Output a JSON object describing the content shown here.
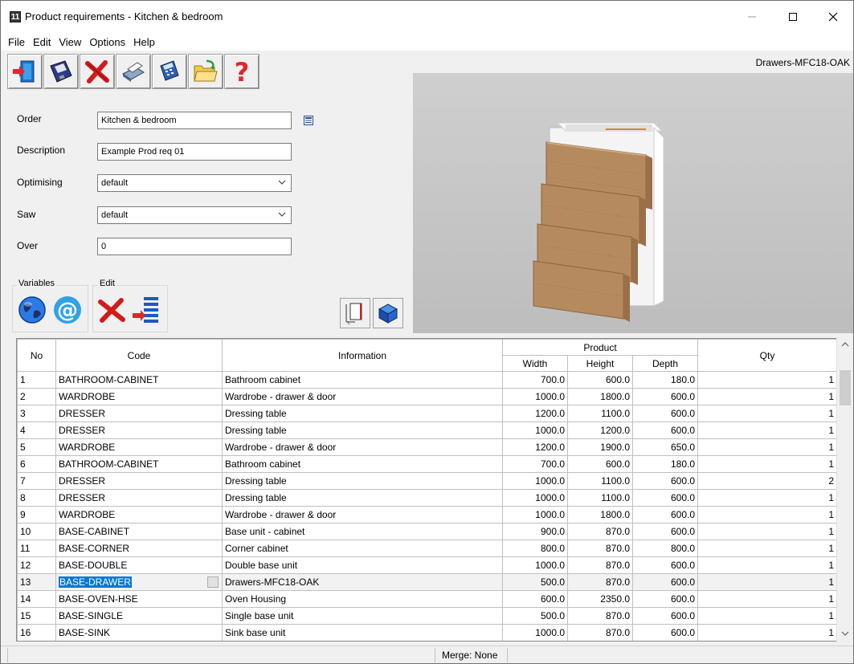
{
  "window": {
    "title": "Product requirements - Kitchen & bedroom",
    "app_icon_text": "11"
  },
  "menu": [
    "File",
    "Edit",
    "View",
    "Options",
    "Help"
  ],
  "toolbar": {
    "icons": [
      "exit-icon",
      "save-icon",
      "delete-icon",
      "print-icon",
      "calculator-icon",
      "open-folder-icon",
      "help-icon"
    ]
  },
  "preview": {
    "cabinet_name": "Drawers-MFC18-OAK"
  },
  "form": {
    "order_label": "Order",
    "order_value": "Kitchen & bedroom",
    "description_label": "Description",
    "description_value": "Example Prod req 01",
    "optimising_label": "Optimising",
    "optimising_value": "default",
    "saw_label": "Saw",
    "saw_value": "default",
    "over_label": "Over",
    "over_value": "0"
  },
  "groups": {
    "variables_label": "Variables",
    "edit_label": "Edit"
  },
  "grid": {
    "headers": {
      "no": "No",
      "code": "Code",
      "information": "Information",
      "product": "Product",
      "width": "Width",
      "height": "Height",
      "depth": "Depth",
      "qty": "Qty"
    },
    "rows": [
      {
        "no": "1",
        "code": "BATHROOM-CABINET",
        "info": "Bathroom cabinet",
        "width": "700.0",
        "height": "600.0",
        "depth": "180.0",
        "qty": "1"
      },
      {
        "no": "2",
        "code": "WARDROBE",
        "info": "Wardrobe - drawer & door",
        "width": "1000.0",
        "height": "1800.0",
        "depth": "600.0",
        "qty": "1"
      },
      {
        "no": "3",
        "code": "DRESSER",
        "info": "Dressing table",
        "width": "1200.0",
        "height": "1100.0",
        "depth": "600.0",
        "qty": "1"
      },
      {
        "no": "4",
        "code": "DRESSER",
        "info": "Dressing table",
        "width": "1000.0",
        "height": "1200.0",
        "depth": "600.0",
        "qty": "1"
      },
      {
        "no": "5",
        "code": "WARDROBE",
        "info": "Wardrobe - drawer & door",
        "width": "1200.0",
        "height": "1900.0",
        "depth": "650.0",
        "qty": "1"
      },
      {
        "no": "6",
        "code": "BATHROOM-CABINET",
        "info": "Bathroom cabinet",
        "width": "700.0",
        "height": "600.0",
        "depth": "180.0",
        "qty": "1"
      },
      {
        "no": "7",
        "code": "DRESSER",
        "info": "Dressing table",
        "width": "1000.0",
        "height": "1100.0",
        "depth": "600.0",
        "qty": "2"
      },
      {
        "no": "8",
        "code": "DRESSER",
        "info": "Dressing table",
        "width": "1000.0",
        "height": "1100.0",
        "depth": "600.0",
        "qty": "1"
      },
      {
        "no": "9",
        "code": "WARDROBE",
        "info": "Wardrobe - drawer & door",
        "width": "1000.0",
        "height": "1800.0",
        "depth": "600.0",
        "qty": "1"
      },
      {
        "no": "10",
        "code": "BASE-CABINET",
        "info": "Base unit - cabinet",
        "width": "900.0",
        "height": "870.0",
        "depth": "600.0",
        "qty": "1"
      },
      {
        "no": "11",
        "code": "BASE-CORNER",
        "info": "Corner cabinet",
        "width": "800.0",
        "height": "870.0",
        "depth": "800.0",
        "qty": "1"
      },
      {
        "no": "12",
        "code": "BASE-DOUBLE",
        "info": "Double base unit",
        "width": "1000.0",
        "height": "870.0",
        "depth": "600.0",
        "qty": "1"
      },
      {
        "no": "13",
        "code": "BASE-DRAWER",
        "info": "Drawers-MFC18-OAK",
        "width": "500.0",
        "height": "870.0",
        "depth": "600.0",
        "qty": "1",
        "selected": true
      },
      {
        "no": "14",
        "code": "BASE-OVEN-HSE",
        "info": "Oven Housing",
        "width": "600.0",
        "height": "2350.0",
        "depth": "600.0",
        "qty": "1"
      },
      {
        "no": "15",
        "code": "BASE-SINGLE",
        "info": "Single base unit",
        "width": "500.0",
        "height": "870.0",
        "depth": "600.0",
        "qty": "1"
      },
      {
        "no": "16",
        "code": "BASE-SINK",
        "info": "Sink base unit",
        "width": "1000.0",
        "height": "870.0",
        "depth": "600.0",
        "qty": "1"
      }
    ]
  },
  "status": {
    "merge": "Merge: None"
  }
}
